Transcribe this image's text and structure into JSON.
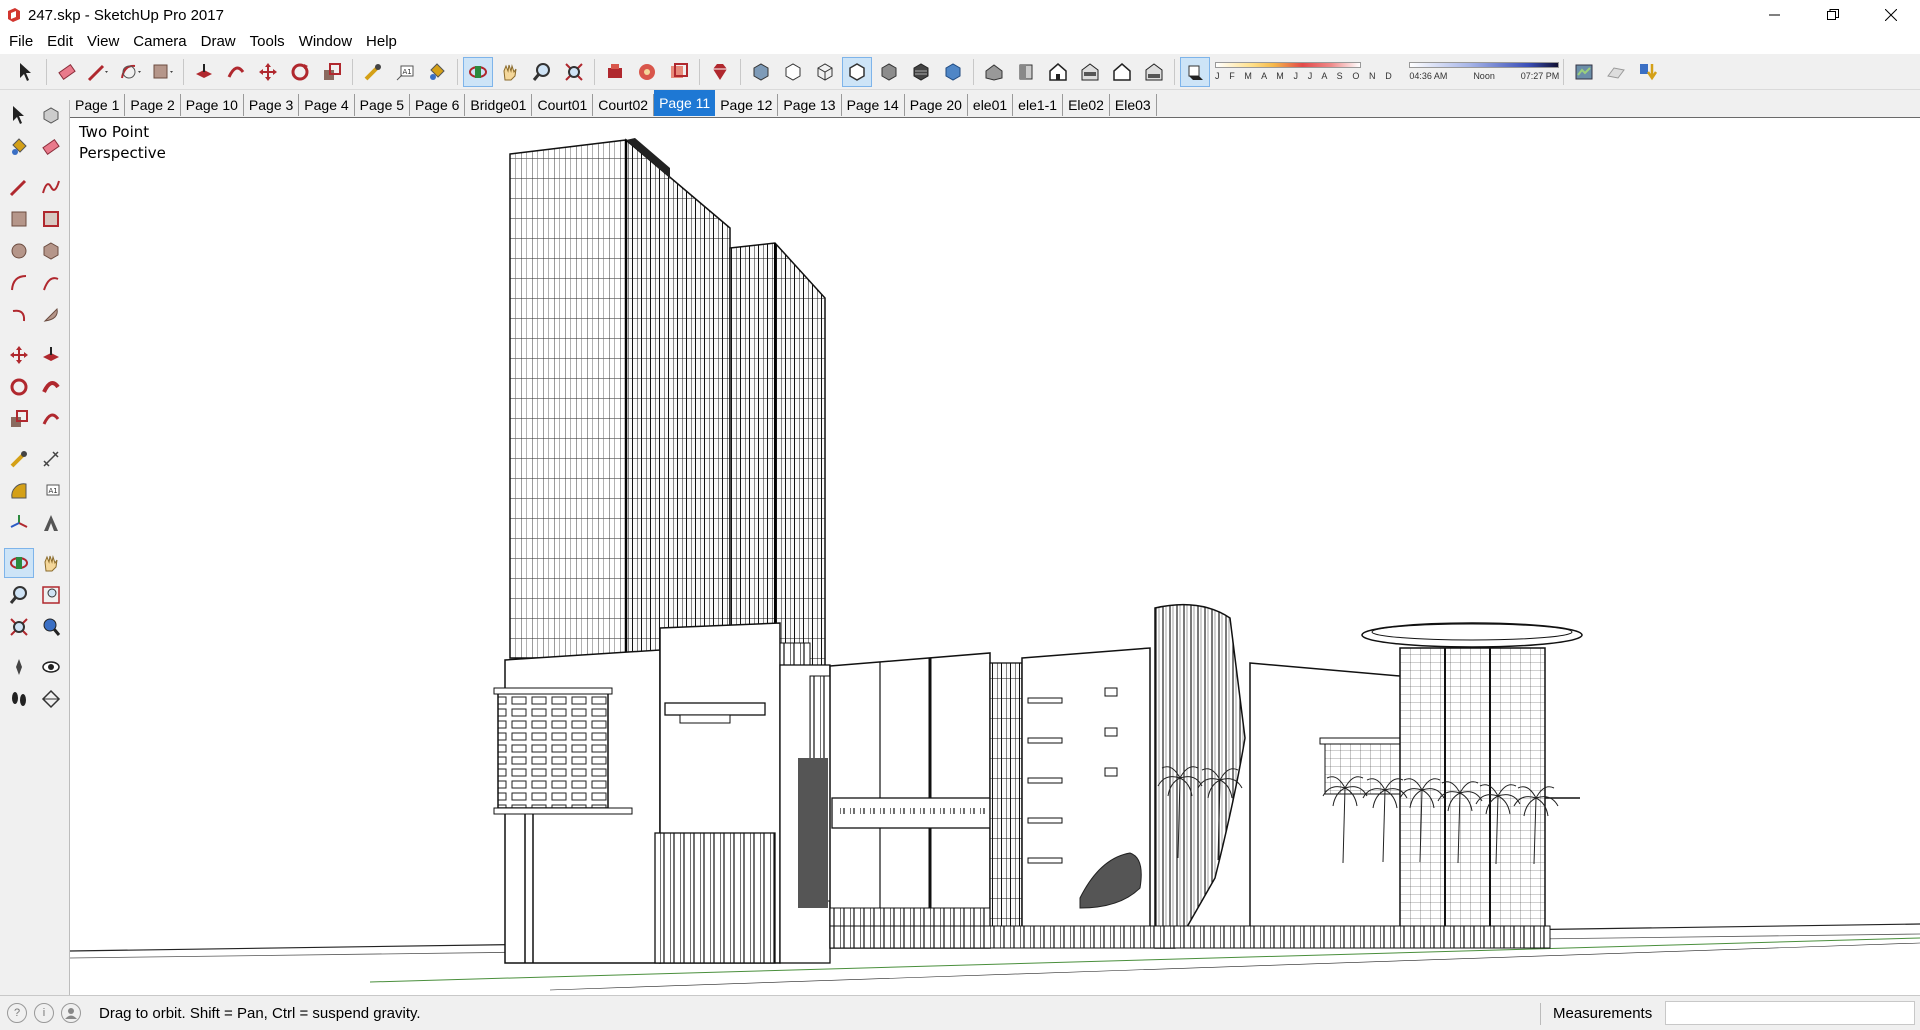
{
  "window": {
    "title": "247.skp - SketchUp Pro 2017"
  },
  "menu": [
    "File",
    "Edit",
    "View",
    "Camera",
    "Draw",
    "Tools",
    "Window",
    "Help"
  ],
  "toolbar": {
    "buttons": [
      "select-icon",
      "eraser-icon",
      "pencil-icon",
      "arc-icon",
      "rectangle-icon",
      "push-pull-icon",
      "offset-icon",
      "move-icon",
      "rotate-icon",
      "scale-icon",
      "tape-measure-icon",
      "text-icon",
      "paint-bucket-icon",
      "orbit-icon",
      "pan-icon",
      "zoom-icon",
      "zoom-extents-icon",
      "warehouse-icon",
      "extension-warehouse-icon",
      "layout-icon",
      "ruby-icon",
      "xray-icon",
      "back-edges-icon",
      "wireframe-icon",
      "hidden-line-icon",
      "shaded-icon",
      "shaded-textures-icon",
      "monochrome-icon",
      "iso-view-icon",
      "top-view-icon",
      "front-view-icon",
      "right-view-icon",
      "back-view-icon",
      "left-view-icon",
      "shadows-icon"
    ],
    "shadow_months": "J F M A M J J A S O N D",
    "time_start": "04:36 AM",
    "time_noon": "Noon",
    "time_end": "07:27 PM"
  },
  "scene_tabs": [
    "Page 1",
    "Page 2",
    "Page 10",
    "Page 3",
    "Page 4",
    "Page 5",
    "Page 6",
    "Bridge01",
    "Court01",
    "Court02",
    "Page 11",
    "Page 12",
    "Page 13",
    "Page 14",
    "Page 20",
    "ele01",
    "ele1-1",
    "Ele02",
    "Ele03"
  ],
  "active_scene": "Page 11",
  "viewport": {
    "camera_line1": "Two Point",
    "camera_line2": "Perspective"
  },
  "status": {
    "hint": "Drag to orbit. Shift = Pan, Ctrl = suspend gravity.",
    "measurements_label": "Measurements",
    "measurements_value": ""
  },
  "colors": {
    "accent": "#1e78d4",
    "active_tool_bg": "#cde4f7",
    "icon_red": "#b0282e"
  }
}
